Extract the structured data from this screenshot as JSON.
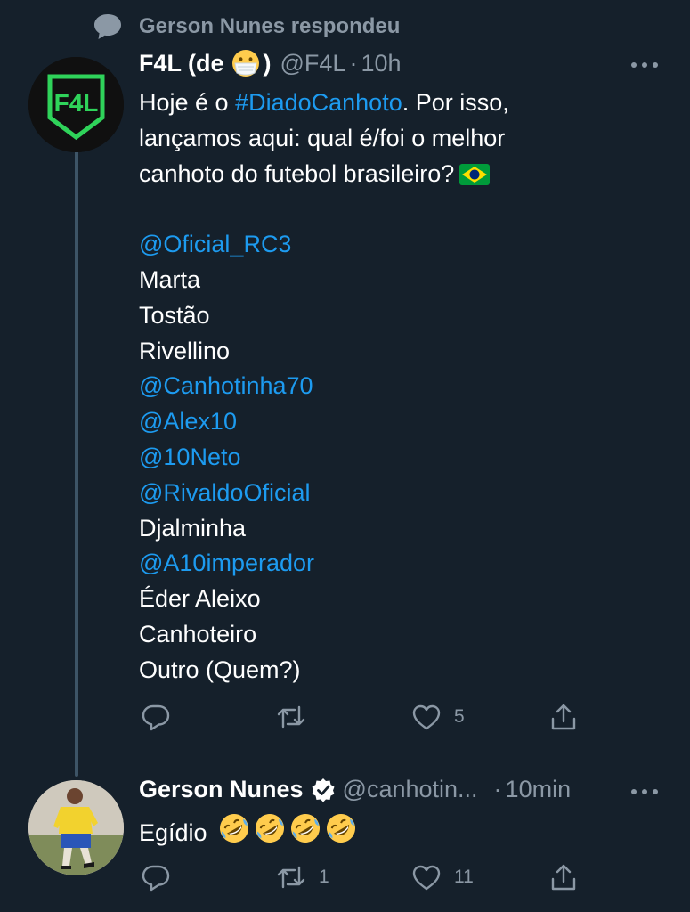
{
  "context": {
    "text": "Gerson Nunes respondeu",
    "icon": "reply-bubble-icon"
  },
  "tweet1": {
    "name_prefix": "F4L (de",
    "name_suffix": ")",
    "name_emoji": "mask-face-emoji",
    "handle": "@F4L",
    "dot": "·",
    "time": "10h",
    "avatar_text": "F4L",
    "lines": [
      {
        "t": "Hoje é o ",
        "link": "#DiadoCanhoto",
        "rest": ". Por isso,"
      },
      {
        "t": "lançamos aqui: qual é/foi o melhor"
      },
      {
        "t": "canhoto do futebol brasileiro?",
        "emoji": "brazil-flag-emoji"
      },
      {
        "t": ""
      },
      {
        "link": "@Oficial_RC3"
      },
      {
        "t": "Marta"
      },
      {
        "t": "Tostão"
      },
      {
        "t": "Rivellino"
      },
      {
        "link": "@Canhotinha70"
      },
      {
        "link": "@Alex10"
      },
      {
        "link": "@10Neto"
      },
      {
        "link": "@RivaldoOficial"
      },
      {
        "t": "Djalminha"
      },
      {
        "link": "@A10imperador"
      },
      {
        "t": "Éder Aleixo"
      },
      {
        "t": "Canhoteiro"
      },
      {
        "t": "Outro (Quem?)"
      }
    ],
    "actions": {
      "reply": "",
      "retweet": "",
      "like": "5",
      "share": ""
    }
  },
  "tweet2": {
    "name": "Gerson Nunes",
    "verified": "verified-badge-icon",
    "handle": "@canhotin...",
    "dot": "·",
    "time": "10min",
    "text": "Egídio",
    "emoji": "rolling-on-floor-laughing-emoji",
    "emoji_count": 4,
    "actions": {
      "reply": "",
      "retweet": "1",
      "like": "11",
      "share": ""
    }
  },
  "colors": {
    "background": "#15202b",
    "secondary": "#8b98a5",
    "link": "#1d9bf0",
    "thread_line": "#3d5466",
    "f4l_green": "#2fd35a"
  }
}
